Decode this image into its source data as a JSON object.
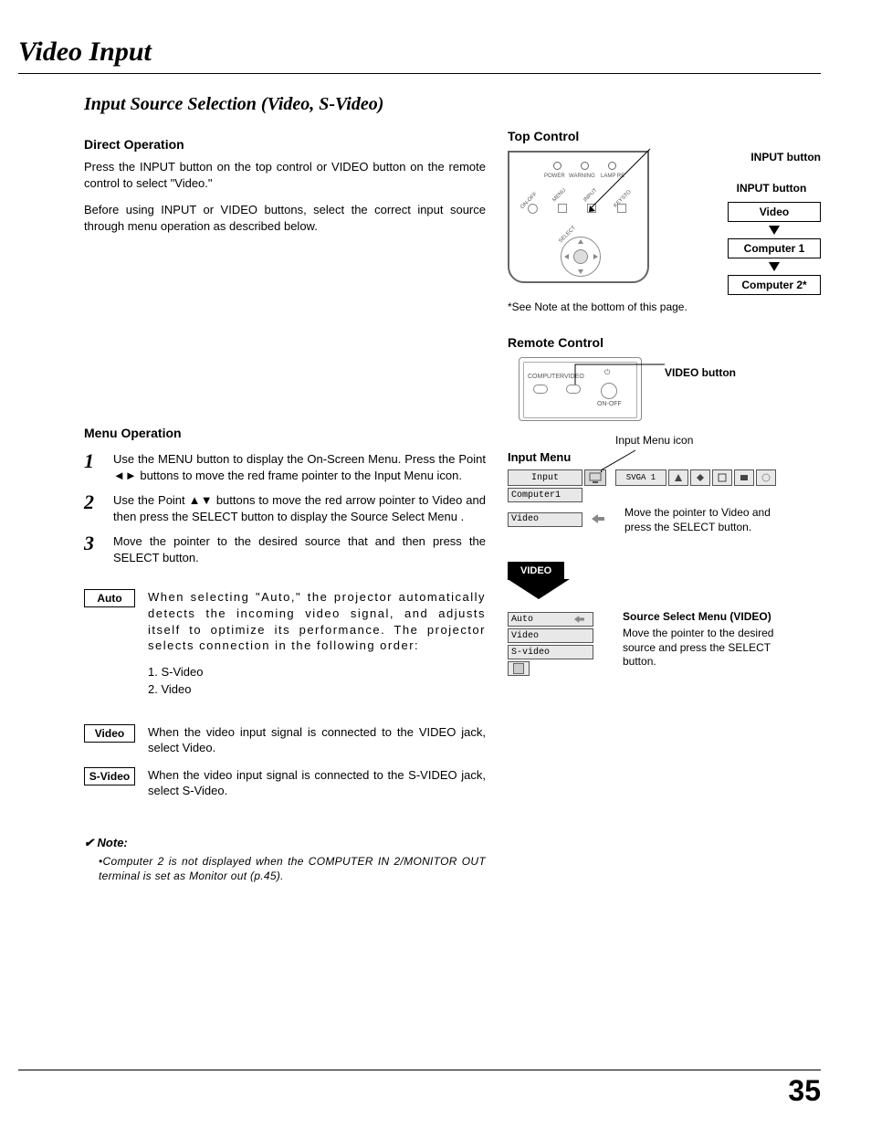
{
  "page_title": "Video Input",
  "subheading": "Input Source Selection (Video, S-Video)",
  "direct_operation": {
    "heading": "Direct Operation",
    "p1": "Press the INPUT button on the top control or VIDEO button on the remote control to select \"Video.\"",
    "p2": "Before using INPUT or VIDEO buttons, select the correct input source through menu operation as described below."
  },
  "menu_operation": {
    "heading": "Menu Operation",
    "step1": "Use the MENU button to display the On-Screen Menu. Press the Point ◄► buttons to move the red frame pointer to the Input Menu icon.",
    "step2": "Use the Point ▲▼ buttons to move the red arrow pointer to Video and then press the SELECT button to display the Source Select Menu .",
    "step3": "Move the pointer to the desired source that and then press the SELECT button."
  },
  "modes": {
    "auto": {
      "label": "Auto",
      "desc": "When selecting \"Auto,\" the projector automatically detects the incoming video signal, and adjusts itself to optimize its performance. The projector selects connection in the following order:",
      "order1": "1. S-Video",
      "order2": "2. Video"
    },
    "video": {
      "label": "Video",
      "desc": "When the video input signal is connected to the VIDEO jack, select Video."
    },
    "svideo": {
      "label": "S-Video",
      "desc": "When the video input signal is connected to the S-VIDEO jack, select S-Video."
    }
  },
  "note": {
    "head_prefix": "✔",
    "head": "Note:",
    "body": "•Computer 2 is not displayed when the COMPUTER IN 2/MONITOR OUT terminal is set as Monitor out (p.45)."
  },
  "top_control": {
    "heading": "Top Control",
    "input_button_arrow": "INPUT button",
    "input_button_flow": "INPUT button",
    "options": {
      "video": "Video",
      "computer1": "Computer 1",
      "computer2": "Computer 2*"
    },
    "see_note": "*See Note at the bottom of this page.",
    "device_labels": {
      "power": "POWER",
      "warning": "WARNING",
      "lamp": "LAMP RE",
      "onoff": "ON-OFF",
      "menu": "MENU",
      "input": "INPUT",
      "keysto": "KEYSTO",
      "select": "SELECT"
    }
  },
  "remote_control": {
    "heading": "Remote Control",
    "video_button": "VIDEO button",
    "computer_label": "COMPUTER",
    "video_label": "VIDEO",
    "onoff_label": "ON-OFF"
  },
  "input_menu": {
    "heading": "Input Menu",
    "icon_label": "Input Menu icon",
    "input_label": "Input",
    "svga": "SVGA 1",
    "rows": {
      "computer1": "Computer1",
      "video": "Video"
    },
    "move_pointer": "Move the pointer to Video and press the SELECT button.",
    "video_tab": "VIDEO"
  },
  "source_menu": {
    "heading": "Source Select Menu (VIDEO)",
    "desc": "Move the pointer to the desired source and press the SELECT button.",
    "rows": {
      "auto": "Auto",
      "video": "Video",
      "svideo": "S-video"
    }
  },
  "page_number": "35"
}
